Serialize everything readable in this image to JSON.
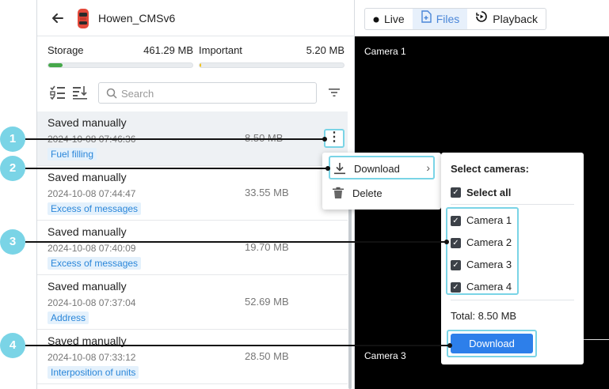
{
  "header": {
    "title": "Howen_CMSv6"
  },
  "storage": {
    "label": "Storage",
    "value": "461.29 MB",
    "fill_percent": 10,
    "fill_color": "#46a84a"
  },
  "important": {
    "label": "Important",
    "value": "5.20 MB",
    "fill_percent": 1,
    "fill_color": "#f2c21a"
  },
  "search": {
    "placeholder": "Search"
  },
  "files": [
    {
      "title": "Saved manually",
      "date": "2024-10-08 07:46:36",
      "size": "8.50 MB",
      "tag": "Fuel filling"
    },
    {
      "title": "Saved manually",
      "date": "2024-10-08 07:44:47",
      "size": "33.55 MB",
      "tag": "Excess of messages"
    },
    {
      "title": "Saved manually",
      "date": "2024-10-08 07:40:09",
      "size": "19.70 MB",
      "tag": "Excess of messages"
    },
    {
      "title": "Saved manually",
      "date": "2024-10-08 07:37:04",
      "size": "52.69 MB",
      "tag": "Address"
    },
    {
      "title": "Saved manually",
      "date": "2024-10-08 07:33:12",
      "size": "28.50 MB",
      "tag": "Interposition of units"
    }
  ],
  "mode_tabs": [
    {
      "label": "Live",
      "icon": "dot-icon"
    },
    {
      "label": "Files",
      "icon": "file-icon"
    },
    {
      "label": "Playback",
      "icon": "playback-icon"
    }
  ],
  "video": {
    "camera_top": "Camera 1",
    "camera_bottom": "Camera 3"
  },
  "context_menu": {
    "download": "Download",
    "delete": "Delete"
  },
  "camera_popup": {
    "title": "Select cameras:",
    "select_all": "Select all",
    "cameras": [
      "Camera 1",
      "Camera 2",
      "Camera 3",
      "Camera 4"
    ],
    "total": "Total: 8.50 MB",
    "download_button": "Download"
  },
  "callouts": [
    "1",
    "2",
    "3",
    "4"
  ],
  "colors": {
    "accent": "#2d7fea",
    "callout": "#7ad4e6",
    "tag_text": "#2a86d9",
    "tag_bg": "#e4f1fc"
  }
}
